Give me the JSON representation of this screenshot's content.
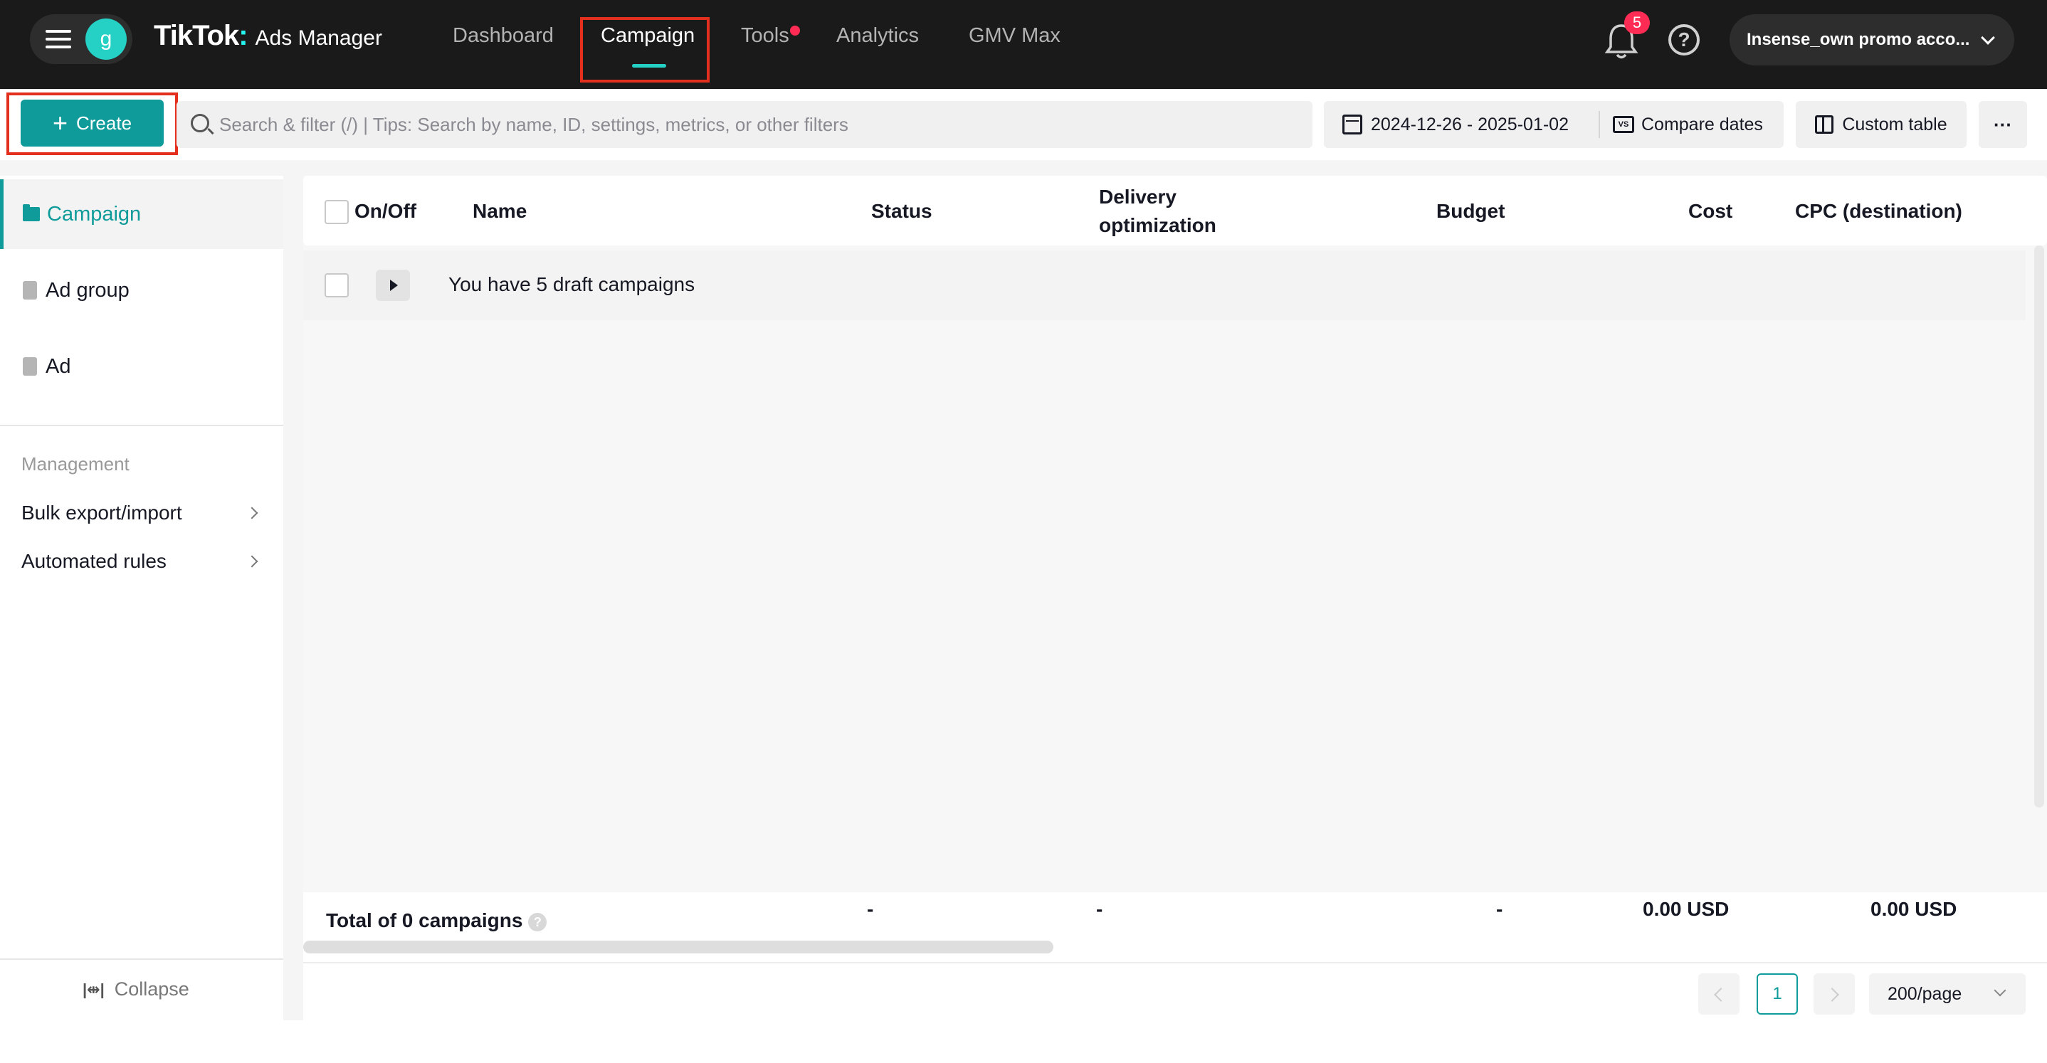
{
  "header": {
    "avatar_initial": "g",
    "brand": "TikTok",
    "brand_sub": "Ads Manager",
    "nav": [
      {
        "label": "Dashboard"
      },
      {
        "label": "Campaign"
      },
      {
        "label": "Tools"
      },
      {
        "label": "Analytics"
      },
      {
        "label": "GMV Max"
      }
    ],
    "notification_count": "5",
    "help_symbol": "?",
    "account_label": "Insense_own promo acco..."
  },
  "toolbar": {
    "create_label": "Create",
    "search_placeholder": "Search & filter (/) | Tips: Search by name, ID, settings, metrics, or other filters",
    "date_range": "2024-12-26 - 2025-01-02",
    "compare_label": "Compare dates",
    "compare_icon_text": "VS",
    "custom_table_label": "Custom table",
    "more_label": "···"
  },
  "sidebar": {
    "items": [
      {
        "label": "Campaign"
      },
      {
        "label": "Ad group"
      },
      {
        "label": "Ad"
      }
    ],
    "section_title": "Management",
    "links": [
      {
        "label": "Bulk export/import"
      },
      {
        "label": "Automated rules"
      }
    ],
    "collapse_icon": "|⇹|",
    "collapse_label": "Collapse"
  },
  "table": {
    "columns": [
      "On/Off",
      "Name",
      "Status",
      "Delivery",
      "optimization",
      "Budget",
      "Cost",
      "CPC (destination)"
    ],
    "draft_text": "You have 5 draft campaigns",
    "totals": {
      "label": "Total of 0 campaigns",
      "help": "?",
      "status": "-",
      "delivery": "-",
      "budget": "-",
      "cost": "0.00 USD",
      "cpc": "0.00 USD"
    },
    "pagination": {
      "current_page": "1",
      "page_size": "200/page"
    }
  }
}
